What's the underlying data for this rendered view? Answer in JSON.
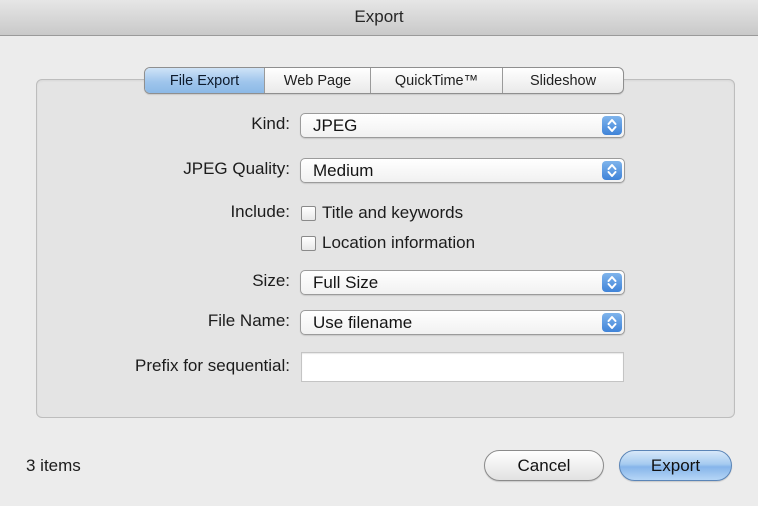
{
  "window": {
    "title": "Export"
  },
  "tabs": [
    {
      "label": "File Export",
      "selected": true
    },
    {
      "label": "Web Page",
      "selected": false
    },
    {
      "label": "QuickTime™",
      "selected": false
    },
    {
      "label": "Slideshow",
      "selected": false
    }
  ],
  "form": {
    "kind": {
      "label": "Kind:",
      "value": "JPEG"
    },
    "jpeg_quality": {
      "label": "JPEG Quality:",
      "value": "Medium"
    },
    "include": {
      "label": "Include:",
      "options": [
        {
          "label": "Title and keywords",
          "checked": false
        },
        {
          "label": "Location information",
          "checked": false
        }
      ]
    },
    "size": {
      "label": "Size:",
      "value": "Full Size"
    },
    "file_name": {
      "label": "File Name:",
      "value": "Use filename"
    },
    "prefix": {
      "label": "Prefix for sequential:",
      "value": ""
    }
  },
  "footer": {
    "items_count": "3 items",
    "cancel_label": "Cancel",
    "export_label": "Export"
  },
  "colors": {
    "accent_blue": "#8cb9e6",
    "window_bg": "#ececec",
    "stepper_blue": "#3f83d8"
  },
  "icons": {
    "popup_arrows": "up-down-chevron-icon"
  }
}
